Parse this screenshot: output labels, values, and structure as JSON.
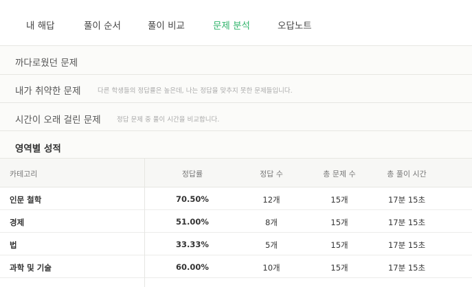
{
  "tabs": [
    {
      "label": "내 해답",
      "active": false
    },
    {
      "label": "풀이 순서",
      "active": false
    },
    {
      "label": "풀이 비교",
      "active": false
    },
    {
      "label": "문제 분석",
      "active": true
    },
    {
      "label": "오답노트",
      "active": false
    }
  ],
  "accent_color": "#2fb36a",
  "sections": [
    {
      "title": "까다로웠던 문제",
      "desc": ""
    },
    {
      "title": "내가 취약한 문제",
      "desc": "다른 학생들의 정답률은 높은데, 나는 정답을 맞추지 못한 문제들입니다."
    },
    {
      "title": "시간이 오래 걸린 문제",
      "desc": "정답 문제 중 풀이 시간을 비교합니다."
    }
  ],
  "scores": {
    "title": "영역별 성적",
    "headers": [
      "카테고리",
      "정답률",
      "정답 수",
      "총 문제 수",
      "총 풀이 시간"
    ],
    "rows": [
      [
        "인문 철학",
        "70.50%",
        "12개",
        "15개",
        "17분 15초"
      ],
      [
        "경제",
        "51.00%",
        "8개",
        "15개",
        "17분 15초"
      ],
      [
        "법",
        "33.33%",
        "5개",
        "15개",
        "17분 15초"
      ],
      [
        "과학 및 기술",
        "60.00%",
        "10개",
        "15개",
        "17분 15초"
      ]
    ]
  }
}
